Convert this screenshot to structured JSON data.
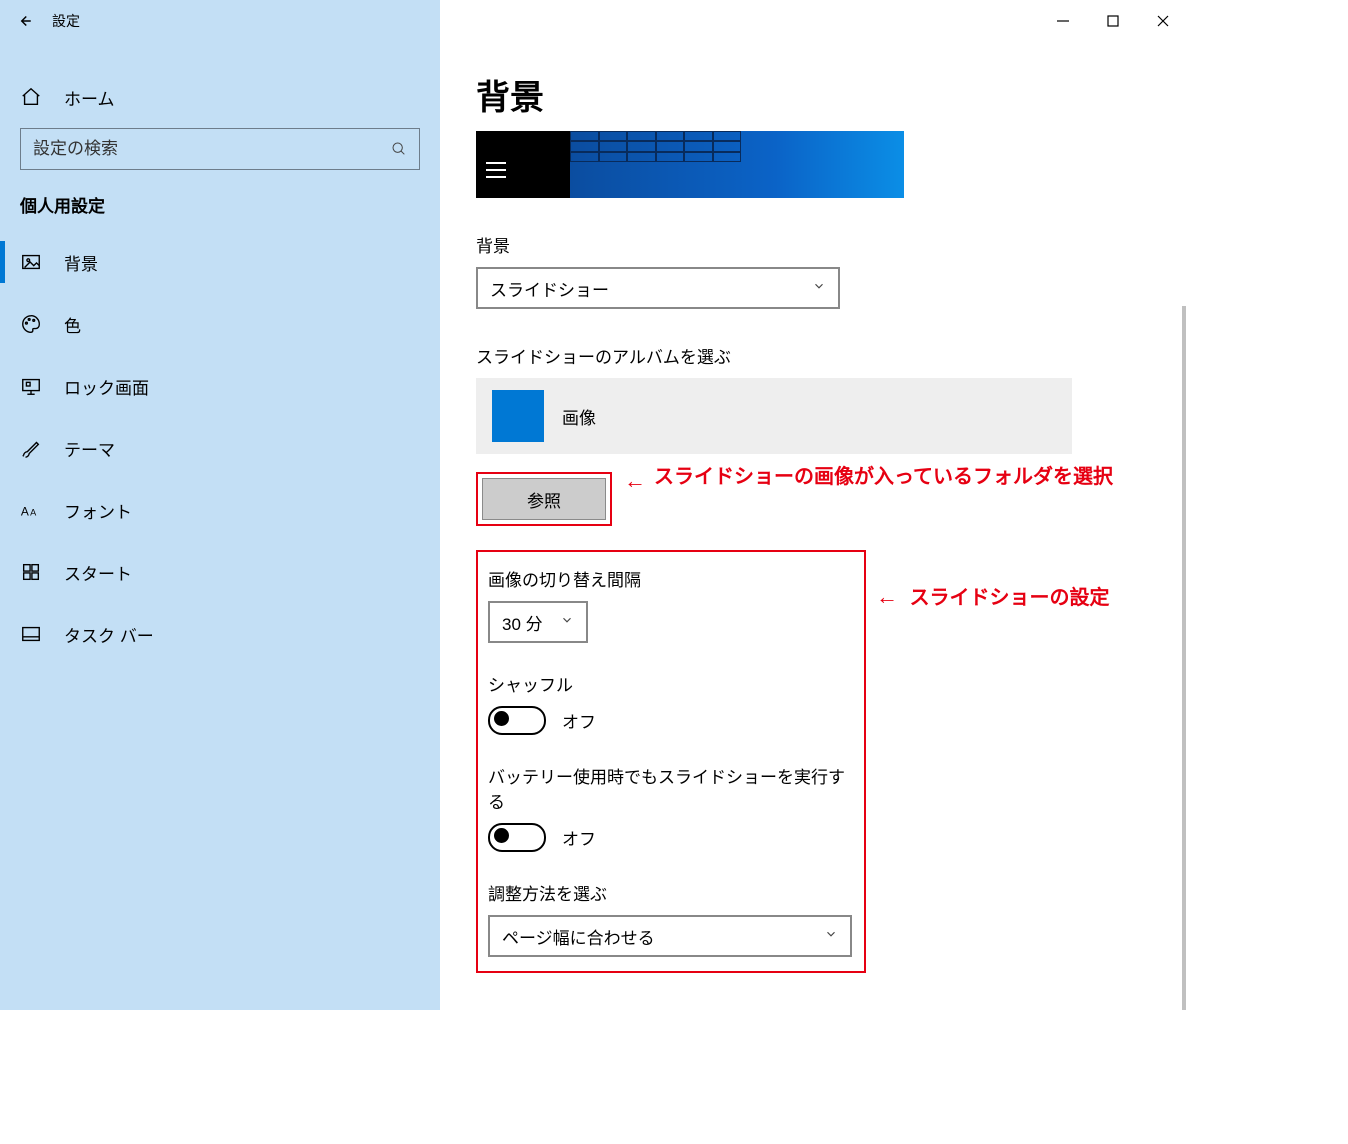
{
  "titlebar": {
    "title": "設定"
  },
  "sidebar": {
    "home_label": "ホーム",
    "search_placeholder": "設定の検索",
    "category_label": "個人用設定",
    "items": [
      {
        "label": "背景"
      },
      {
        "label": "色"
      },
      {
        "label": "ロック画面"
      },
      {
        "label": "テーマ"
      },
      {
        "label": "フォント"
      },
      {
        "label": "スタート"
      },
      {
        "label": "タスク バー"
      }
    ]
  },
  "main": {
    "page_title": "背景",
    "background_label": "背景",
    "background_value": "スライドショー",
    "album_label": "スライドショーのアルバムを選ぶ",
    "album_selected": "画像",
    "browse_button": "参照",
    "interval_label": "画像の切り替え間隔",
    "interval_value": "30 分",
    "shuffle_label": "シャッフル",
    "shuffle_value": "オフ",
    "battery_label": "バッテリー使用時でもスライドショーを実行する",
    "battery_value": "オフ",
    "fit_label": "調整方法を選ぶ",
    "fit_value": "ページ幅に合わせる"
  },
  "annotations": {
    "browse_note": "スライドショーの画像が入っているフォルダを選択",
    "settings_note": "スライドショーの設定"
  }
}
